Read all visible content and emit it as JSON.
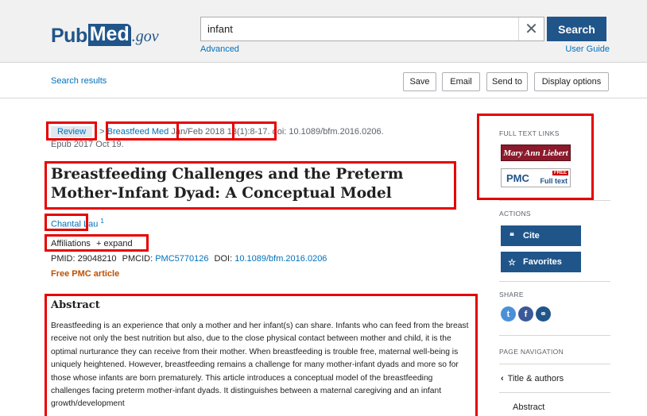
{
  "header": {
    "logo_pub": "Pub",
    "logo_med": "Med",
    "logo_gov": ".gov",
    "search_value": "infant",
    "clear_symbol": "✕",
    "search_label": "Search",
    "advanced_label": "Advanced",
    "user_guide_label": "User Guide"
  },
  "action_bar": {
    "search_results_label": "Search results",
    "save_label": "Save",
    "email_label": "Email",
    "send_to_label": "Send to",
    "display_options_label": "Display options"
  },
  "article": {
    "type_label": "Review",
    "breadcrumb_sep": ">",
    "journal": "Breastfeed Med",
    "date": "Jan/Feb 2018",
    "volume": "13(1):8-17.",
    "doi_text": "doi: 10.1089/bfm.2016.0206.",
    "epub": "Epub 2017 Oct 19.",
    "title": "Breastfeeding Challenges and the Preterm Mother-Infant Dyad: A Conceptual Model",
    "author": "Chantal Lau",
    "author_sup": "1",
    "affiliations_label": "Affiliations",
    "expand_label": "+ expand",
    "pmid_label": "PMID: 29048210",
    "pmcid_label": "PMCID:",
    "pmcid_value": "PMC5770126",
    "doi_label": "DOI:",
    "doi_value": "10.1089/bfm.2016.0206",
    "free_pmc": "Free PMC article",
    "abstract_heading": "Abstract",
    "abstract_text": "Breastfeeding is an experience that only a mother and her infant(s) can share. Infants who can feed from the breast receive not only the best nutrition but also, due to the close physical contact between mother and child, it is the optimal nurturance they can receive from their mother. When breastfeeding is trouble free, maternal well-being is uniquely heightened. However, breastfeeding remains a challenge for many mother-infant dyads and more so for those whose infants are born prematurely. This article introduces a conceptual model of the breastfeeding challenges facing preterm mother-infant dyads. It distinguishes between a maternal caregiving and an infant growth/development"
  },
  "sidebar": {
    "full_text_links_label": "FULL TEXT LINKS",
    "mal_logo_text": "Mary Ann Liebert",
    "pmc_text": "PMC",
    "pmc_free": "FREE",
    "pmc_fulltext": "Full text",
    "actions_label": "ACTIONS",
    "cite_icon": "❝",
    "cite_label": "Cite",
    "favorites_icon": "☆",
    "favorites_label": "Favorites",
    "share_label": "SHARE",
    "twitter_glyph": "t",
    "facebook_glyph": "f",
    "link_glyph": "⚭",
    "page_nav_label": "PAGE NAVIGATION",
    "nav_title_authors": "Title & authors",
    "nav_chevron": "‹",
    "nav_abstract": "Abstract"
  },
  "colors": {
    "brand": "#20558a",
    "link": "#0071bc",
    "annotation": "#e60000",
    "free_pmc": "#bf4f00"
  }
}
